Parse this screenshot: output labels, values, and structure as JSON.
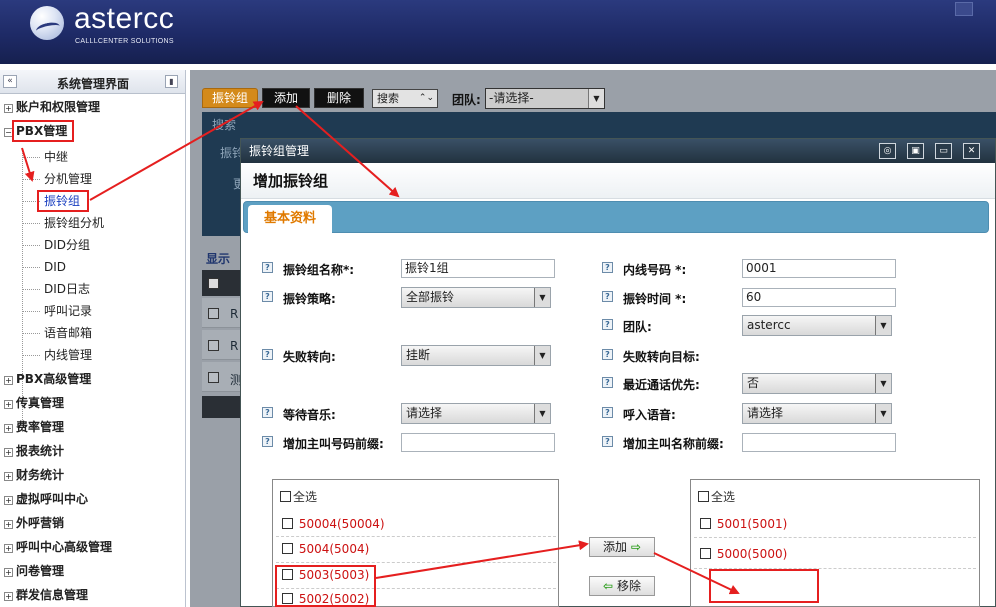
{
  "header": {
    "brand": "astercc",
    "slogan": "CALLLCENTER SOLUTIONS"
  },
  "sidebar": {
    "title": "系统管理界面",
    "groups": [
      "账户和权限管理",
      "PBX管理",
      "PBX高级管理",
      "传真管理",
      "费率管理",
      "报表统计",
      "财务统计",
      "虚拟呼叫中心",
      "外呼营销",
      "呼叫中心高级管理",
      "问卷管理",
      "群发信息管理"
    ],
    "pbx_items": [
      "中继",
      "分机管理",
      "振铃组",
      "振铃组分机",
      "DID分组",
      "DID",
      "DID日志",
      "呼叫记录",
      "语音邮箱",
      "内线管理"
    ]
  },
  "toolbar": {
    "tab_label": "振铃组",
    "add_label": "添加",
    "delete_label": "删除",
    "search_label": "搜索",
    "team_label": "团队:",
    "team_value": "-请选择-"
  },
  "background": {
    "search_title": "搜索",
    "field_1": "振铃",
    "field_2": "更",
    "show_label": "显示",
    "rows": [
      "R",
      "R",
      "测"
    ]
  },
  "dialog": {
    "title": "振铃组管理",
    "heading": "增加振铃组",
    "tab": "基本资料",
    "fields": {
      "name_label": "振铃组名称*:",
      "name_value": "振铃1组",
      "strategy_label": "振铃策略:",
      "strategy_value": "全部振铃",
      "fail_label": "失败转向:",
      "fail_value": "挂断",
      "moh_label": "等待音乐:",
      "moh_value": "请选择",
      "prefix_num_label": "增加主叫号码前缀:",
      "prefix_num_value": "",
      "ext_label": "内线号码 *:",
      "ext_value": "0001",
      "time_label": "振铃时间 *:",
      "time_value": "60",
      "team_label": "团队:",
      "team_value": "astercc",
      "fail_target_label": "失败转向目标:",
      "recent_label": "最近通话优先:",
      "recent_value": "否",
      "greeting_label": "呼入语音:",
      "greeting_value": "请选择",
      "prefix_name_label": "增加主叫名称前缀:",
      "prefix_name_value": ""
    },
    "left_list": {
      "select_all": "全选",
      "items": [
        "50004(50004)",
        "5004(5004)",
        "5003(5003)",
        "5002(5002)"
      ]
    },
    "right_list": {
      "select_all": "全选",
      "items": [
        "5001(5001)",
        "5000(5000)"
      ]
    },
    "add_button": "添加",
    "remove_button": "移除"
  },
  "colors": {
    "annotation": "#e51f1f",
    "header_bg": "#1e2a66",
    "tab_bar": "#5da0c3",
    "tab_text": "#e07a00"
  }
}
